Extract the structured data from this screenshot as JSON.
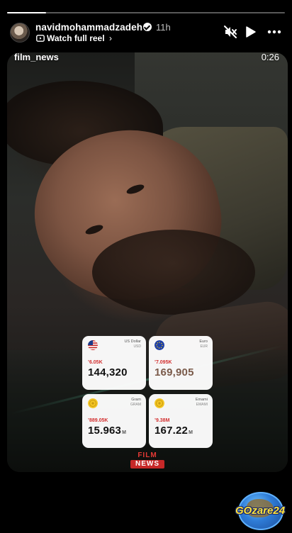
{
  "story": {
    "progress": 0.14,
    "username": "navidmohammadzadeh",
    "verified": true,
    "time_ago": "11h",
    "reel_link": "Watch full reel",
    "post_label": "film_news",
    "duration": "0:26",
    "icons": [
      "mute-icon",
      "play-icon",
      "more-icon",
      "verified-icon",
      "reel-icon"
    ]
  },
  "rates": [
    {
      "name": "US Dollar",
      "code": "USD",
      "change": "’6.05K",
      "value": "144,320",
      "unit": "",
      "flag": "us-flag-icon",
      "change_color": "#d32f2f",
      "value_color": "#111111"
    },
    {
      "name": "Euro",
      "code": "EUR",
      "change": "’7.095K",
      "value": "169,905",
      "unit": "",
      "flag": "eu-flag-icon",
      "change_color": "#d32f2f",
      "value_color": "#7a5a4a"
    },
    {
      "name": "Gram",
      "code": "GRAM",
      "change": "’889.05K",
      "value": "15.963",
      "unit": "M",
      "flag": "gold-coin-icon",
      "change_color": "#d32f2f",
      "value_color": "#111111"
    },
    {
      "name": "Emami",
      "code": "EMAMI",
      "change": "’9.38M",
      "value": "167.22",
      "unit": "M",
      "flag": "gold-coin-icon",
      "change_color": "#d32f2f",
      "value_color": "#111111"
    }
  ],
  "watermark": {
    "top": "FILM",
    "bottom": "NEWS"
  },
  "badge": {
    "text": "GOzare24"
  }
}
